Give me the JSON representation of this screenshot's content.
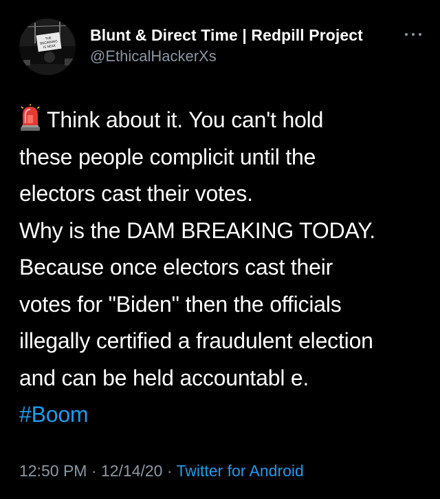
{
  "tweet": {
    "author": {
      "display_name": "Blunt & Direct Time | Redpill Project",
      "handle": "@EthicalHackerXs",
      "avatar_icon": "avatar-photo-sign-the-beginning-is-near"
    },
    "more_icon": "more-options-icon",
    "text": {
      "emoji": "police-light-siren-emoji",
      "lines": [
        "Think about it. You can't hold",
        "these people complicit until the",
        "electors cast their votes.",
        "Why is the DAM BREAKING TODAY.",
        "Because once electors cast their",
        "votes for \"Biden\" then the officials",
        "illegally certified a fraudulent election",
        "and can be held accountabl e."
      ],
      "hashtag": "#Boom"
    },
    "meta": {
      "time": "12:50 PM",
      "separator1": " · ",
      "date": "12/14/20",
      "separator2": " · ",
      "source": "Twitter for Android"
    }
  },
  "colors": {
    "background": "#000000",
    "text": "#ffffff",
    "secondary_text": "#8b98a5",
    "link": "#1d9bf0"
  }
}
